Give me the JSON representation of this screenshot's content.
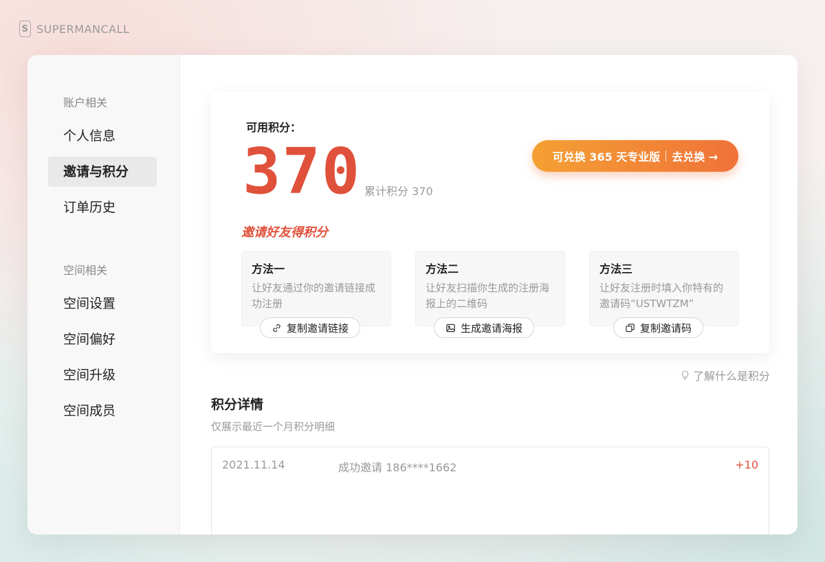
{
  "brand": {
    "name": "SUPERMANCALL"
  },
  "sidebar": {
    "groups": [
      {
        "title": "账户相关",
        "items": [
          "个人信息",
          "邀请与积分",
          "订单历史"
        ]
      },
      {
        "title": "空间相关",
        "items": [
          "空间设置",
          "空间偏好",
          "空间升级",
          "空间成员"
        ]
      }
    ],
    "active": "邀请与积分"
  },
  "points_card": {
    "available_label": "可用积分：",
    "available_points": "370",
    "total_label": "累计积分 370",
    "redeem_left": "可兑换 365 天专业版",
    "redeem_right": "去兑换 →",
    "invite_title": "邀请好友得积分",
    "methods": [
      {
        "title": "方法一",
        "desc": "让好友通过你的邀请链接成功注册",
        "button": "复制邀请链接",
        "icon": "link-icon"
      },
      {
        "title": "方法二",
        "desc": "让好友扫描你生成的注册海报上的二维码",
        "button": "生成邀请海报",
        "icon": "image-icon"
      },
      {
        "title": "方法三",
        "desc": "让好友注册时填入你特有的邀请码“USTWTZM”",
        "button": "复制邀请码",
        "icon": "copy-icon"
      }
    ]
  },
  "learn_more": "了解什么是积分",
  "details": {
    "title": "积分详情",
    "subtitle": "仅展示最近一个月积分明细",
    "rows": [
      {
        "date": "2021.11.14",
        "desc": "成功邀请 186****1662",
        "delta": "+10"
      }
    ]
  },
  "colors": {
    "accent": "#e0513b",
    "button_start": "#f4a034",
    "button_end": "#f07238"
  }
}
